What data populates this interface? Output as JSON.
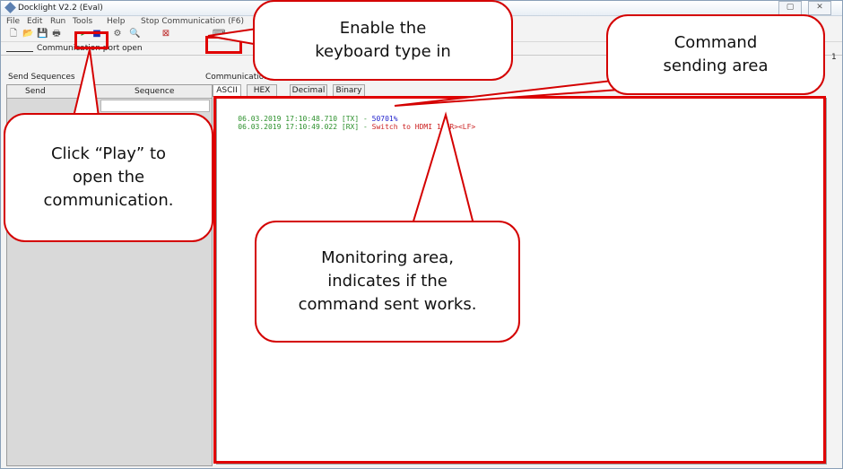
{
  "window": {
    "title": "Docklight V2.2 (Eval)",
    "min_btn": "–",
    "restore_btn": "▢",
    "close_btn": "✕"
  },
  "menu": [
    "File",
    "Edit",
    "Run",
    "Tools",
    "Help",
    "Stop Communication (F6)"
  ],
  "toolbar": {
    "new": "🗋",
    "open": "📂",
    "save": "💾",
    "print": "🖶",
    "play": "▸",
    "stop": "■",
    "props": "⚙",
    "find": "🔍",
    "clear": "⊠",
    "keyboard": "⌨"
  },
  "status": {
    "text": "Communication port open",
    "right_number": "1"
  },
  "send_panel": {
    "title": "Send Sequences",
    "col_send": "Send",
    "col_sequence": "Sequence"
  },
  "comm_panel": {
    "title": "Communication",
    "tabs": [
      "ASCII",
      "HEX",
      "Decimal",
      "Binary"
    ]
  },
  "log": [
    {
      "time": "06.03.2019 17:10:48.710",
      "dir": "[TX]",
      "sep": "-",
      "msg": "50701%",
      "color": "#2222cc"
    },
    {
      "time": "06.03.2019 17:10:49.022",
      "dir": "[RX]",
      "sep": "-",
      "msg": "Switch to HDMI 1<CR><LF>",
      "color": "#cc2222"
    }
  ],
  "log_prefix_color": "#2a8f2a",
  "callouts": {
    "keyboard": "Enable the\nkeyboard type in",
    "command": "Command\nsending area",
    "play": "Click “Play” to\nopen the\ncommunication.",
    "monitor": "Monitoring area,\nindicates if the\ncommand sent works."
  },
  "annotation_color": "#e00000"
}
